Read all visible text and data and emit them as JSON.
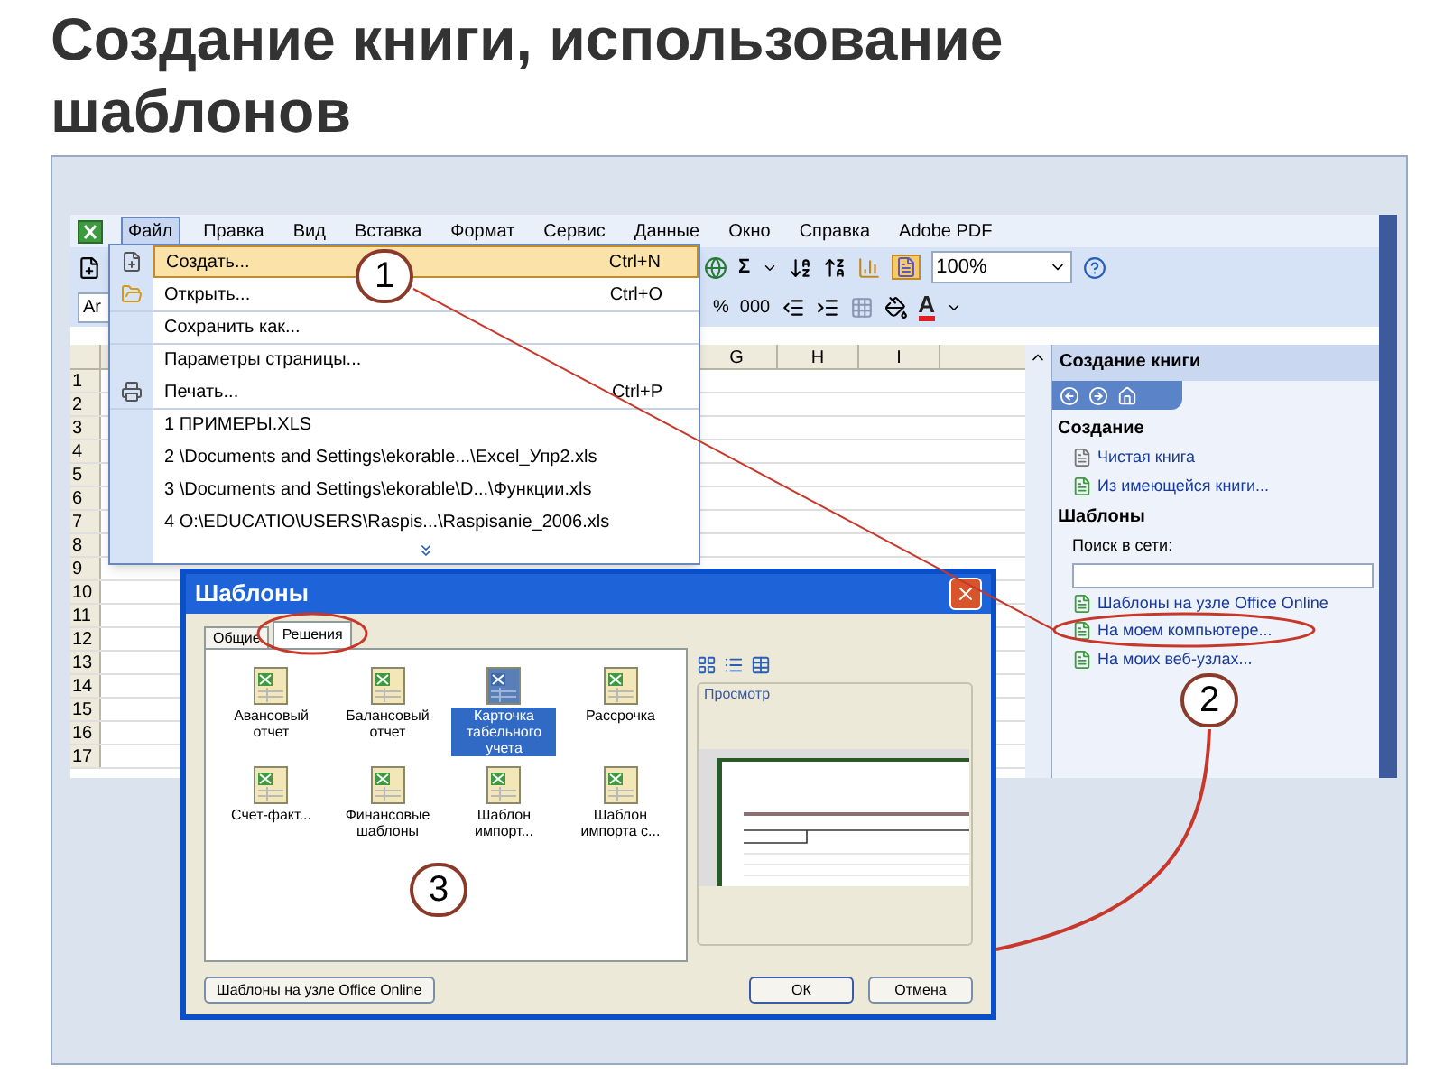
{
  "slide_title": "Создание книги, использование шаблонов",
  "menu_bar": [
    {
      "label": "Файл",
      "selected": true
    },
    {
      "label": "Правка",
      "selected": false
    },
    {
      "label": "Вид",
      "selected": false
    },
    {
      "label": "Вставка",
      "selected": false
    },
    {
      "label": "Формат",
      "selected": false
    },
    {
      "label": "Сервис",
      "selected": false
    },
    {
      "label": "Данные",
      "selected": false
    },
    {
      "label": "Окно",
      "selected": false
    },
    {
      "label": "Справка",
      "selected": false
    },
    {
      "label": "Adobe PDF",
      "selected": false
    }
  ],
  "toolbar": {
    "sum": "Σ",
    "zoom": "100%",
    "font": "Ar",
    "percent": "%",
    "thousands": "000",
    "font_color": "A"
  },
  "file_menu": [
    {
      "kind": "item",
      "label": "Создать...",
      "shortcut": "Ctrl+N",
      "selected": true
    },
    {
      "kind": "item",
      "label": "Открыть...",
      "shortcut": "Ctrl+O",
      "selected": false
    },
    {
      "kind": "item",
      "label": "Сохранить как...",
      "selected": false
    },
    {
      "kind": "item",
      "label": "Параметры страницы...",
      "selected": false
    },
    {
      "kind": "item",
      "label": "Печать...",
      "shortcut": "Ctrl+P",
      "selected": false
    },
    {
      "kind": "recent",
      "label": "1 ПРИМЕРЫ.XLS",
      "selected": false
    },
    {
      "kind": "recent",
      "label": "2 \\Documents and Settings\\ekorable...\\Excel_Упр2.xls",
      "selected": false
    },
    {
      "kind": "recent",
      "label": "3 \\Documents and Settings\\ekorable\\D...\\Функции.xls",
      "selected": false
    },
    {
      "kind": "recent",
      "label": "4 O:\\EDUCATIO\\USERS\\Raspis...\\Raspisanie_2006.xls",
      "selected": false
    }
  ],
  "grid": {
    "columns": [
      "G",
      "H",
      "I"
    ],
    "rows": [
      "1",
      "2",
      "3",
      "4",
      "5",
      "6",
      "7",
      "8",
      "9",
      "10",
      "11",
      "12",
      "13",
      "14",
      "15",
      "16",
      "17"
    ]
  },
  "task_pane": {
    "title": "Создание книги",
    "sections": [
      {
        "heading": "Создание",
        "links": [
          "Чистая книга",
          "Из имеющейся книги..."
        ]
      },
      {
        "heading": "Шаблоны",
        "search_label": "Поиск в сети:",
        "links": [
          "Шаблоны на узле Office Online",
          "На моем компьютере...",
          "На моих веб-узлах..."
        ]
      }
    ]
  },
  "dialog": {
    "title": "Шаблоны",
    "tabs": [
      {
        "label": "Общие",
        "selected": false
      },
      {
        "label": "Решения",
        "selected": true
      }
    ],
    "templates": [
      {
        "label": "Авансовый отчет",
        "selected": false
      },
      {
        "label": "Балансовый отчет",
        "selected": false
      },
      {
        "label": "Карточка табельного учета",
        "selected": true
      },
      {
        "label": "Рассрочка",
        "selected": false
      },
      {
        "label": "Счет-факт...",
        "selected": false
      },
      {
        "label": "Финансовые шаблоны",
        "selected": false
      },
      {
        "label": "Шаблон импорт...",
        "selected": false
      },
      {
        "label": "Шаблон импорта с...",
        "selected": false
      }
    ],
    "preview_label": "Просмотр",
    "online_button": "Шаблоны на узле Office Online",
    "ok_button": "ОК",
    "cancel_button": "Отмена"
  },
  "callouts": [
    "1",
    "2",
    "3"
  ]
}
